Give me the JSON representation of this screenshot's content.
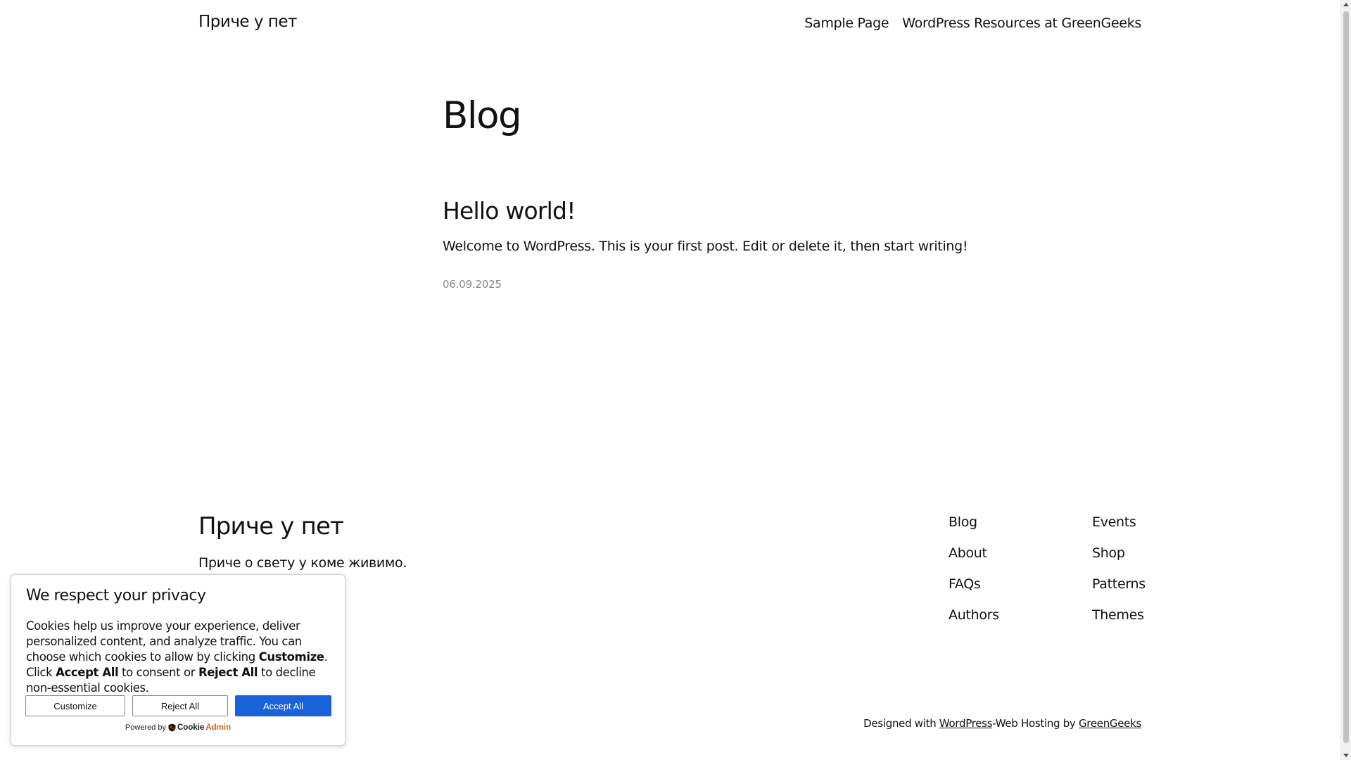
{
  "header": {
    "site_title": "Приче у пет",
    "nav": [
      {
        "label": "Sample Page"
      },
      {
        "label": "WordPress Resources at GreenGeeks"
      }
    ]
  },
  "main": {
    "heading": "Blog",
    "posts": [
      {
        "title": "Hello world!",
        "excerpt": "Welcome to WordPress. This is your first post. Edit or delete it, then start writing!",
        "date": "06.09.2025"
      }
    ]
  },
  "footer": {
    "site_title": "Приче у пет",
    "tagline": "Приче о свету у коме живимо.",
    "col1": [
      "Blog",
      "About",
      "FAQs",
      "Authors"
    ],
    "col2": [
      "Events",
      "Shop",
      "Patterns",
      "Themes"
    ],
    "credits": {
      "prefix": "Designed with ",
      "wordpress": "WordPress",
      "middle": "-Web Hosting by ",
      "greengeeks": "GreenGeeks"
    }
  },
  "cookie_banner": {
    "title": "We respect your privacy",
    "text_1": "Cookies help us improve your experience, deliver personalized content, and analyze traffic. You can choose which cookies to allow by clicking ",
    "bold_customize": "Customize",
    "text_2": ". Click ",
    "bold_accept": "Accept All",
    "text_3": " to consent or ",
    "bold_reject": "Reject All",
    "text_4": " to decline non-essential cookies.",
    "buttons": {
      "customize": "Customize",
      "reject": "Reject All",
      "accept": "Accept All"
    },
    "powered_by": "Powered by",
    "logo_part1": "Cookie",
    "logo_part2": "Admin",
    "accent_color": "#1863dc"
  }
}
